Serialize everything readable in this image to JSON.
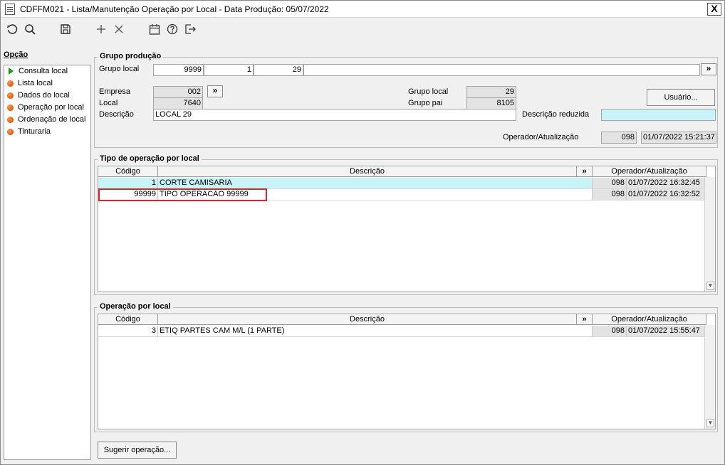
{
  "window": {
    "title": "CDFFM021 - Lista/Manutenção Operação por Local - Data Produção: 05/07/2022",
    "close_label": "X"
  },
  "toolbar": {
    "icons": [
      "undo-icon",
      "search-icon",
      "save-icon",
      "add-icon",
      "delete-icon",
      "calendar-icon",
      "help-icon",
      "exit-icon"
    ]
  },
  "sidebar": {
    "title": "Opção",
    "items": [
      {
        "label": "Consulta local",
        "icon": "green-triangle-icon"
      },
      {
        "label": "Lista local",
        "icon": "orange-dot-icon"
      },
      {
        "label": "Dados do local",
        "icon": "orange-dot-icon"
      },
      {
        "label": "Operação por local",
        "icon": "orange-dot-icon"
      },
      {
        "label": "Ordenação de local",
        "icon": "orange-dot-icon"
      },
      {
        "label": "Tinturaria",
        "icon": "orange-dot-icon"
      }
    ]
  },
  "grupo": {
    "title": "Grupo produção",
    "grupo_local_label": "Grupo local",
    "grupo_local_values": [
      "9999",
      "1",
      "29"
    ],
    "nav_label": "»",
    "empresa_label": "Empresa",
    "empresa_value": "002",
    "local_label": "Local",
    "local_value": "7640",
    "descricao_label": "Descrição",
    "descricao_value": "LOCAL 29",
    "grupo_local2_label": "Grupo local",
    "grupo_local2_value": "29",
    "grupo_pai_label": "Grupo pai",
    "grupo_pai_value": "8105",
    "descricao_reduzida_label": "Descrição reduzida",
    "descricao_reduzida_value": "",
    "usuario_button": "Usuário...",
    "operador_label": "Operador/Atualização",
    "operador_value": "098",
    "atualizacao_value": "01/07/2022 15:21:37"
  },
  "tipo_operacao": {
    "title": "Tipo de operação por local",
    "headers": [
      "Código",
      "Descrição",
      "»",
      "Operador/Atualização"
    ],
    "rows": [
      {
        "codigo": "1",
        "descricao": "CORTE CAMISARIA",
        "operador": "098",
        "data": "01/07/2022 16:32:45"
      },
      {
        "codigo": "99999",
        "descricao": "TIPO OPERACAO 99999",
        "operador": "098",
        "data": "01/07/2022 16:32:52"
      }
    ]
  },
  "operacao_local": {
    "title": "Operação por local",
    "headers": [
      "Código",
      "Descrição",
      "»",
      "Operador/Atualização"
    ],
    "rows": [
      {
        "codigo": "3",
        "descricao": "ETIQ PARTES CAM M/L (1 PARTE)",
        "operador": "098",
        "data": "01/07/2022 15:55:47"
      }
    ]
  },
  "sugerir_button": "Sugerir operação...",
  "colors": {
    "selected_row": "#c8f4f8",
    "highlight": "#d9262c",
    "readonly": "#e3e3e3"
  }
}
